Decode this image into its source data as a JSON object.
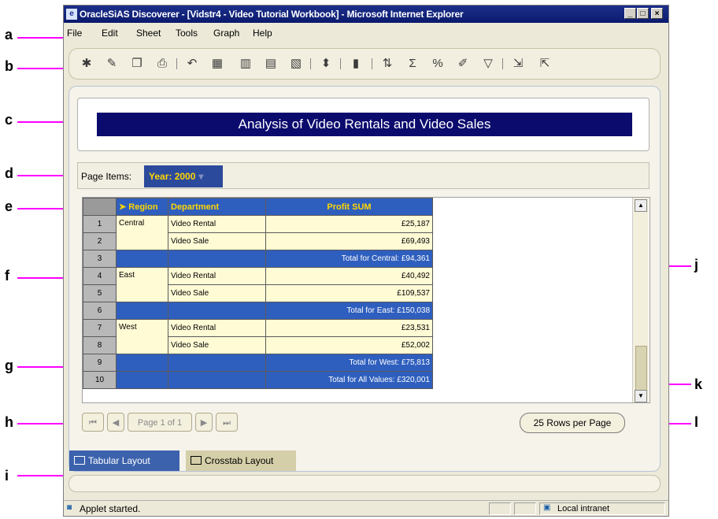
{
  "window": {
    "title": "OracleSiAS Discoverer - [Vidstr4 - Video Tutorial Workbook] - Microsoft Internet Explorer",
    "minimize": "_",
    "maximize": "□",
    "close": "×"
  },
  "menu": [
    "File",
    "Edit",
    "Sheet",
    "Tools",
    "Graph",
    "Help"
  ],
  "toolbar_icons": [
    "new-icon",
    "edit-icon",
    "open-icon",
    "print-icon",
    "undo-icon",
    "table-icon",
    "crosstab-icon",
    "chart-icon",
    "pivot-icon",
    "drill-icon",
    "graph-icon",
    "sort-icon",
    "sum-icon",
    "percent-icon",
    "calc-icon",
    "filter-icon",
    "export-icon",
    "import-icon"
  ],
  "report": {
    "title": "Analysis of Video Rentals and Video Sales"
  },
  "page_items": {
    "label": "Page Items:",
    "year": "Year: 2000"
  },
  "table": {
    "headers": {
      "region": "Region",
      "department": "Department",
      "profit": "Profit SUM"
    },
    "rows": [
      {
        "n": "1",
        "region": "Central",
        "dept": "Video Rental",
        "profit": "£25,187"
      },
      {
        "n": "2",
        "region": "",
        "dept": "Video Sale",
        "profit": "£69,493"
      },
      {
        "n": "3",
        "total": "Total for Central: £94,361"
      },
      {
        "n": "4",
        "region": "East",
        "dept": "Video Rental",
        "profit": "£40,492"
      },
      {
        "n": "5",
        "region": "",
        "dept": "Video Sale",
        "profit": "£109,537"
      },
      {
        "n": "6",
        "total": "Total for East: £150,038"
      },
      {
        "n": "7",
        "region": "West",
        "dept": "Video Rental",
        "profit": "£23,531"
      },
      {
        "n": "8",
        "region": "",
        "dept": "Video Sale",
        "profit": "£52,002"
      },
      {
        "n": "9",
        "total": "Total for West: £75,813"
      },
      {
        "n": "10",
        "total": "Total for All Values: £320,001"
      }
    ]
  },
  "pager": {
    "first": "⏮",
    "prev": "◀",
    "page": "Page 1 of 1",
    "next": "▶",
    "last": "⏭",
    "rows_per_page": "25 Rows per Page"
  },
  "tabs": {
    "tabular": "Tabular Layout",
    "crosstab": "Crosstab Layout"
  },
  "status": {
    "text": "Applet started.",
    "zone": "Local intranet"
  },
  "callouts": [
    "a",
    "b",
    "c",
    "d",
    "e",
    "f",
    "g",
    "h",
    "i",
    "j",
    "k",
    "l"
  ]
}
